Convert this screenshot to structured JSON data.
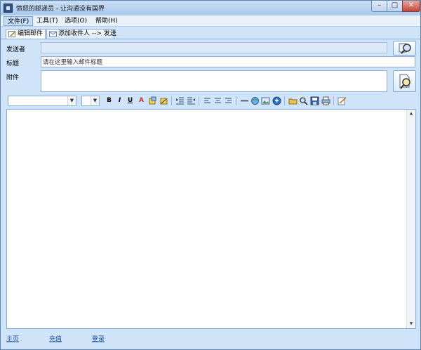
{
  "window": {
    "title": "愤怒的邮递员 - 让沟通没有国界",
    "min_symbol": "–",
    "max_symbol": "□",
    "close_symbol": "✕"
  },
  "menu": {
    "items": [
      "文件(F)",
      "工具(T)",
      "选项(O)",
      "帮助(H)"
    ],
    "active_index": 0
  },
  "tabs": [
    {
      "label": "编辑邮件",
      "icon": "pencil-icon",
      "active": true
    },
    {
      "label": "添加收件人 --> 发送",
      "icon": "envelope-icon",
      "active": false
    }
  ],
  "form": {
    "sender_label": "发送者",
    "sender_value": "",
    "subject_label": "标题",
    "subject_placeholder": "请在这里输入邮件标题",
    "attachment_label": "附件",
    "attachment_value": "",
    "sender_button_icon": "search-contact-icon",
    "attachment_button_icon": "attach-file-icon"
  },
  "toolbar": {
    "font_select": "",
    "size_select": "",
    "bold": "B",
    "italic": "I",
    "underline": "U",
    "font_color": "A",
    "icons": [
      "bold-icon",
      "italic-icon",
      "underline-icon",
      "font-color-icon",
      "highlight-icon",
      "clear-format-icon",
      "outdent-icon",
      "indent-icon",
      "align-left-icon",
      "align-center-icon",
      "align-right-icon",
      "horizontal-line-icon",
      "insert-link-icon",
      "insert-image-icon",
      "insert-emoji-icon",
      "open-file-icon",
      "find-icon",
      "save-icon",
      "print-icon",
      "edit-source-icon"
    ]
  },
  "footer": {
    "links": [
      "主页",
      "充值",
      "登录"
    ]
  },
  "colors": {
    "window_bg": "#cfe4f8",
    "link": "#1f4e99",
    "border": "#8eadd6"
  }
}
